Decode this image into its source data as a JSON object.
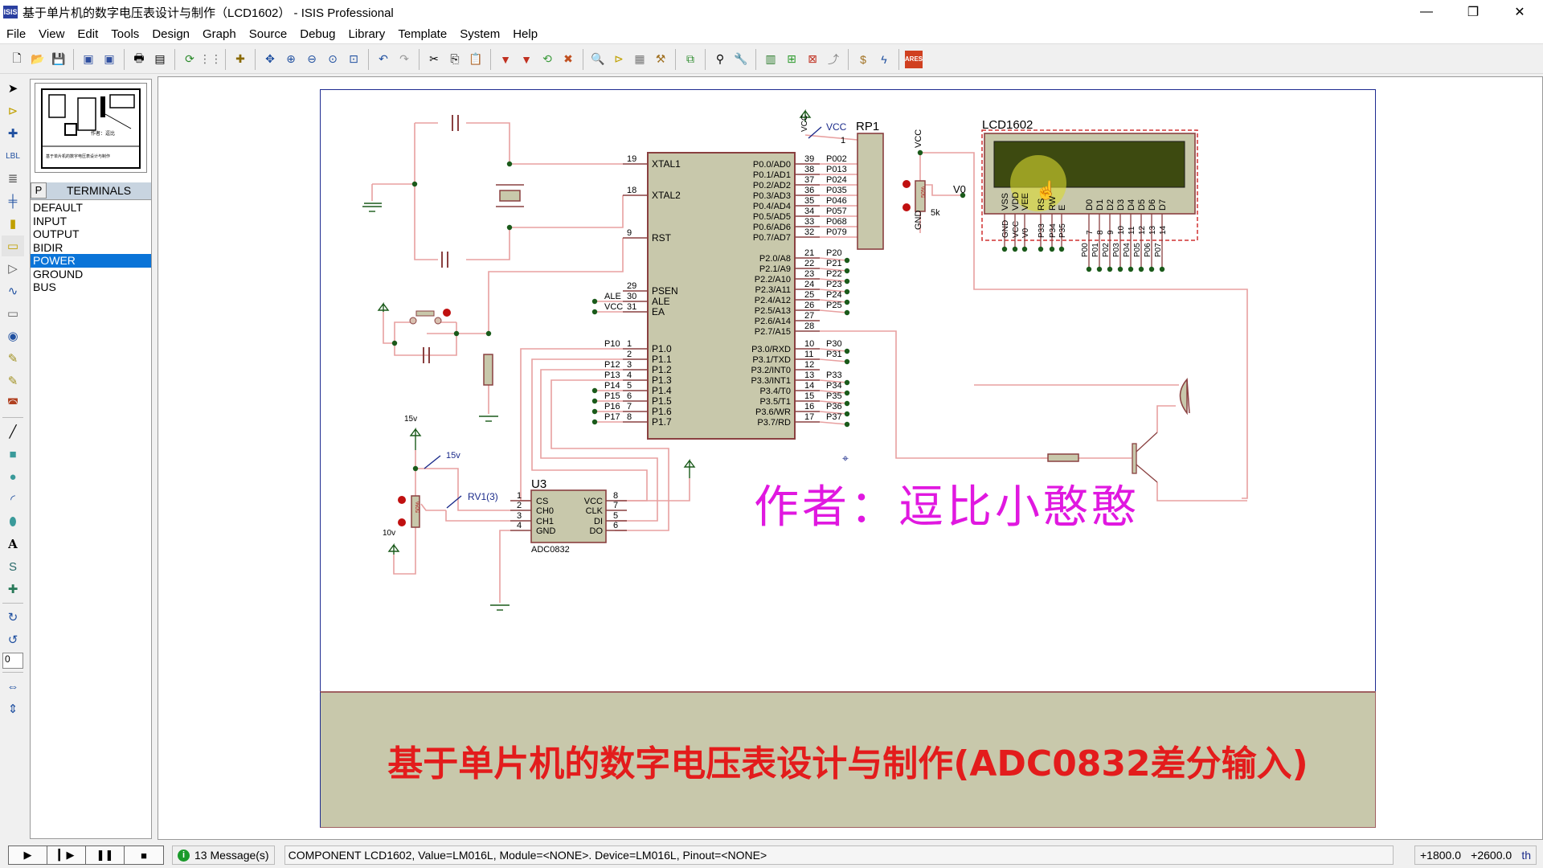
{
  "window": {
    "app_icon": "ISIS",
    "title": "基于单片机的数字电压表设计与制作（LCD1602） - ISIS Professional",
    "controls": {
      "minimize": "—",
      "restore": "❐",
      "close": "✕"
    }
  },
  "menu": [
    "File",
    "View",
    "Edit",
    "Tools",
    "Design",
    "Graph",
    "Source",
    "Debug",
    "Library",
    "Template",
    "System",
    "Help"
  ],
  "toolbar_icons": [
    "new-file",
    "open-file",
    "save-file",
    "import-section",
    "export-section",
    "print",
    "print-area",
    "refresh",
    "grid",
    "origin",
    "pan",
    "zoom-in",
    "zoom-out",
    "zoom-all",
    "zoom-area",
    "undo",
    "redo",
    "cut",
    "copy",
    "paste",
    "block-copy",
    "block-move",
    "block-rotate",
    "block-delete",
    "pick-device",
    "make-device",
    "packaging-tool",
    "decompose",
    "wire-autorouter",
    "search",
    "property-assignment",
    "design-explorer",
    "new-sheet",
    "remove-sheet",
    "goto-parent",
    "bill-of-materials",
    "electrical-rules-check",
    "netlist-to-ares"
  ],
  "left_tools": [
    "selection",
    "component",
    "junction-dot",
    "wire-label",
    "text-script",
    "buses",
    "subcircuit",
    "terminals",
    "device-pins",
    "graph",
    "tape-recorder",
    "generator",
    "voltage-probe",
    "current-probe",
    "virtual-instruments",
    "2d-line",
    "2d-box",
    "2d-circle",
    "2d-arc",
    "2d-path",
    "2d-text",
    "2d-symbols",
    "2d-markers",
    "rotate-clockwise",
    "rotate-anticlockwise",
    "x-mirror",
    "y-mirror"
  ],
  "rotation_value": "0",
  "side_panel": {
    "mode_button": "P",
    "title": "TERMINALS",
    "items": [
      "DEFAULT",
      "INPUT",
      "OUTPUT",
      "BIDIR",
      "POWER",
      "GROUND",
      "BUS"
    ],
    "selected": "POWER"
  },
  "schematic": {
    "mcu": {
      "left_pins": [
        {
          "num": "19",
          "name": "XTAL1"
        },
        {
          "num": "18",
          "name": "XTAL2"
        },
        {
          "num": "9",
          "name": "RST"
        },
        {
          "num": "29",
          "name": "PSEN"
        },
        {
          "num": "30",
          "name": "ALE",
          "net": "ALE"
        },
        {
          "num": "31",
          "name": "EA",
          "net": "VCC"
        },
        {
          "num": "1",
          "name": "P1.0",
          "net": "P10"
        },
        {
          "num": "2",
          "name": "P1.1",
          "net": ""
        },
        {
          "num": "3",
          "name": "P1.2",
          "net": "P12"
        },
        {
          "num": "4",
          "name": "P1.3",
          "net": "P13"
        },
        {
          "num": "5",
          "name": "P1.4",
          "net": "P14"
        },
        {
          "num": "6",
          "name": "P1.5",
          "net": "P15"
        },
        {
          "num": "7",
          "name": "P1.6",
          "net": "P16"
        },
        {
          "num": "8",
          "name": "P1.7",
          "net": "P17"
        }
      ],
      "right_pins": [
        {
          "num": "39",
          "name": "P0.0/AD0",
          "net": "P002"
        },
        {
          "num": "38",
          "name": "P0.1/AD1",
          "net": "P013"
        },
        {
          "num": "37",
          "name": "P0.2/AD2",
          "net": "P024"
        },
        {
          "num": "36",
          "name": "P0.3/AD3",
          "net": "P035"
        },
        {
          "num": "35",
          "name": "P0.4/AD4",
          "net": "P046"
        },
        {
          "num": "34",
          "name": "P0.5/AD5",
          "net": "P057"
        },
        {
          "num": "33",
          "name": "P0.6/AD6",
          "net": "P068"
        },
        {
          "num": "32",
          "name": "P0.7/AD7",
          "net": "P079"
        },
        {
          "num": "21",
          "name": "P2.0/A8",
          "net": "P20"
        },
        {
          "num": "22",
          "name": "P2.1/A9",
          "net": "P21"
        },
        {
          "num": "23",
          "name": "P2.2/A10",
          "net": "P22"
        },
        {
          "num": "24",
          "name": "P2.3/A11",
          "net": "P23"
        },
        {
          "num": "25",
          "name": "P2.4/A12",
          "net": "P24"
        },
        {
          "num": "26",
          "name": "P2.5/A13",
          "net": "P25"
        },
        {
          "num": "27",
          "name": "P2.6/A14",
          "net": ""
        },
        {
          "num": "28",
          "name": "P2.7/A15",
          "net": ""
        },
        {
          "num": "10",
          "name": "P3.0/RXD",
          "net": "P30"
        },
        {
          "num": "11",
          "name": "P3.1/TXD",
          "net": "P31"
        },
        {
          "num": "12",
          "name": "P3.2/INT0",
          "net": ""
        },
        {
          "num": "13",
          "name": "P3.3/INT1",
          "net": "P33"
        },
        {
          "num": "14",
          "name": "P3.4/T0",
          "net": "P34"
        },
        {
          "num": "15",
          "name": "P3.5/T1",
          "net": "P35"
        },
        {
          "num": "16",
          "name": "P3.6/WR",
          "net": "P36"
        },
        {
          "num": "17",
          "name": "P3.7/RD",
          "net": "P37"
        }
      ]
    },
    "rp1": {
      "label": "RP1",
      "pin1": "1",
      "vcc_label": "VCC",
      "vcc_terminal": "VCC"
    },
    "pot": {
      "vcc": "VCC",
      "gnd": "GND",
      "value": "5k",
      "wiper": "V0",
      "pct": "50%"
    },
    "lcd": {
      "label": "LCD1602",
      "pins": [
        "VSS",
        "VDD",
        "VEE",
        "RS",
        "RW",
        "E",
        "D0",
        "D1",
        "D2",
        "D3",
        "D4",
        "D5",
        "D6",
        "D7"
      ],
      "nets_left": [
        "GND",
        "VCC",
        "V0",
        "P33",
        "P34",
        "P35"
      ],
      "pin_numbers": [
        "7",
        "8",
        "9",
        "10",
        "11",
        "12",
        "13",
        "14"
      ],
      "nets_data": [
        "P00",
        "P01",
        "P02",
        "P03",
        "P04",
        "P05",
        "P06",
        "P07"
      ]
    },
    "adc": {
      "ref": "U3",
      "part": "ADC0832",
      "left_pins": [
        {
          "num": "1",
          "name": "CS"
        },
        {
          "num": "2",
          "name": "CH0"
        },
        {
          "num": "3",
          "name": "CH1"
        },
        {
          "num": "4",
          "name": "GND"
        }
      ],
      "right_pins": [
        {
          "num": "8",
          "name": "VCC"
        },
        {
          "num": "7",
          "name": "CLK"
        },
        {
          "num": "5",
          "name": "DI"
        },
        {
          "num": "6",
          "name": "DO"
        }
      ]
    },
    "rv1": {
      "label": "RV1(3)",
      "top": "15v",
      "bottom": "10v",
      "probe": "15v",
      "pct": "50%"
    },
    "author": "作者：逗比小憨憨",
    "banner": "基于单片机的数字电压表设计与制作(ADC0832差分输入)"
  },
  "status": {
    "sim_buttons": [
      "play",
      "step",
      "pause",
      "stop"
    ],
    "messages": "13 Message(s)",
    "text": "COMPONENT LCD1602, Value=LM016L, Module=<NONE>. Device=LM016L, Pinout=<NONE>",
    "x": "+1800.0",
    "y": "+2600.0",
    "unit": "th"
  }
}
